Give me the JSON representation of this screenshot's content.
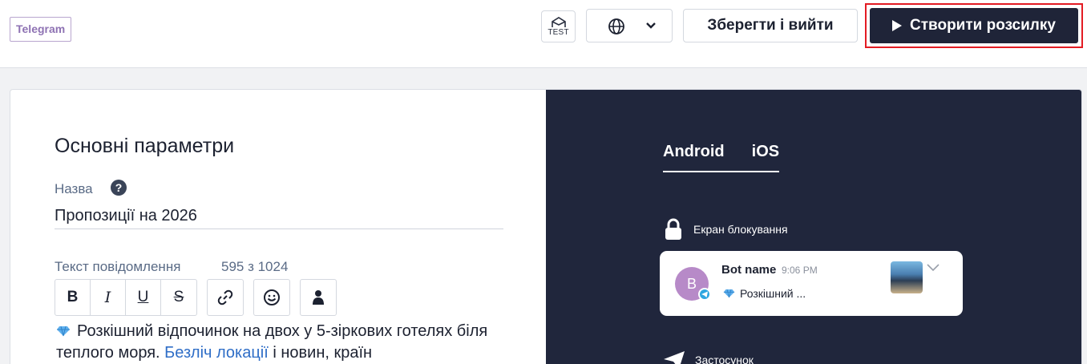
{
  "header": {
    "channel_badge": "Telegram",
    "test_label": "TEST",
    "save_label": "Зберегти і вийти",
    "create_label": "Створити розсилку"
  },
  "form": {
    "section_title": "Основні параметри",
    "name_label": "Назва",
    "name_value": "Пропозиції на 2026",
    "text_label": "Текст повідомлення",
    "char_count": "595 з 1024",
    "toolbar": {
      "bold": "B",
      "italic": "I",
      "underline": "U",
      "strike": "S"
    },
    "message": {
      "part1": "Розкішний відпочинок на двох у 5-зіркових готелях біля теплого моря.",
      "link": "Безліч локації",
      "part2": "і новин, країн"
    }
  },
  "preview": {
    "tabs": [
      "Android",
      "iOS"
    ],
    "active_tab": "Android",
    "lock_screen_label": "Екран блокування",
    "notification": {
      "avatar_letter": "B",
      "bot_name": "Bot name",
      "time": "9:06 PM",
      "text": "Розкішний ..."
    },
    "app_label": "Застосунок"
  },
  "colors": {
    "primary_dark": "#1f2438",
    "highlight_red": "#e31b23",
    "preview_bg": "#20263c",
    "link": "#2f6ec7",
    "channel_purple": "#8e72b3"
  }
}
